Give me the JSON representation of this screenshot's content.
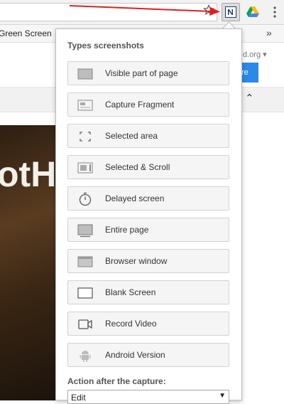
{
  "bookmarks": {
    "item": "Green Screen",
    "overflow": "»"
  },
  "page": {
    "url_fragment": "d.org ▾",
    "button_fragment": "re",
    "collapse_glyph": "⌃",
    "photo_text": "otH"
  },
  "popup": {
    "heading": "Types screenshots",
    "options": [
      {
        "label": "Visible part of page",
        "icon": "visible-page-icon"
      },
      {
        "label": "Capture Fragment",
        "icon": "fragment-icon"
      },
      {
        "label": "Selected area",
        "icon": "selected-area-icon"
      },
      {
        "label": "Selected & Scroll",
        "icon": "selected-scroll-icon"
      },
      {
        "label": "Delayed screen",
        "icon": "timer-icon"
      },
      {
        "label": "Entire page",
        "icon": "entire-page-icon"
      },
      {
        "label": "Browser window",
        "icon": "browser-window-icon"
      },
      {
        "label": "Blank Screen",
        "icon": "blank-screen-icon"
      },
      {
        "label": "Record Video",
        "icon": "video-camera-icon"
      },
      {
        "label": "Android Version",
        "icon": "android-icon"
      }
    ],
    "action_label": "Action after the capture:",
    "action_value": "Edit",
    "action_arrow": "▼"
  },
  "colors": {
    "accent_arrow": "#e02020",
    "page_button": "#2a8ae6"
  }
}
